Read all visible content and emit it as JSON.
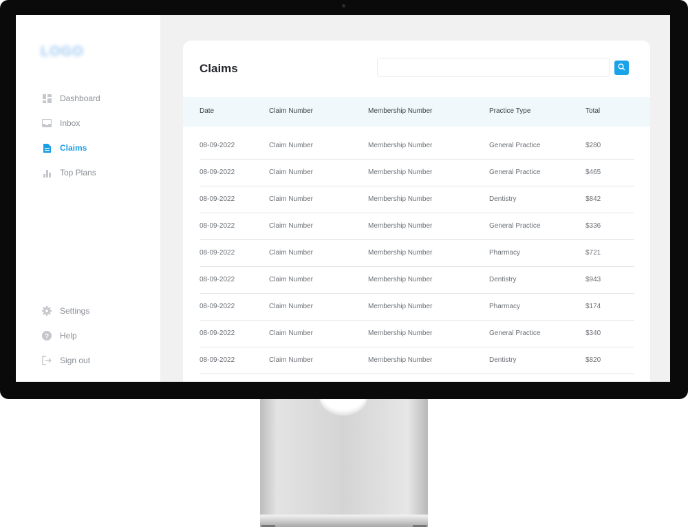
{
  "app": {
    "logo_text": "LOGO"
  },
  "sidebar": {
    "items": [
      {
        "label": "Dashboard",
        "icon": "dashboard-icon",
        "active": false
      },
      {
        "label": "Inbox",
        "icon": "inbox-icon",
        "active": false
      },
      {
        "label": "Claims",
        "icon": "document-icon",
        "active": true
      },
      {
        "label": "Top Plans",
        "icon": "bar-chart-icon",
        "active": false
      }
    ],
    "bottom_items": [
      {
        "label": "Settings",
        "icon": "gear-icon"
      },
      {
        "label": "Help",
        "icon": "help-icon"
      },
      {
        "label": "Sign out",
        "icon": "sign-out-icon"
      }
    ]
  },
  "main": {
    "title": "Claims",
    "search": {
      "placeholder": "",
      "value": ""
    },
    "table": {
      "columns": [
        "Date",
        "Claim Number",
        "Membership Number",
        "Practice Type",
        "Total"
      ],
      "rows": [
        [
          "08-09-2022",
          "Claim Number",
          "Membership Number",
          "General Practice",
          "$280"
        ],
        [
          "08-09-2022",
          "Claim Number",
          "Membership Number",
          "General Practice",
          "$465"
        ],
        [
          "08-09-2022",
          "Claim Number",
          "Membership Number",
          "Dentistry",
          "$842"
        ],
        [
          "08-09-2022",
          "Claim Number",
          "Membership Number",
          "General Practice",
          "$336"
        ],
        [
          "08-09-2022",
          "Claim Number",
          "Membership Number",
          "Pharmacy",
          "$721"
        ],
        [
          "08-09-2022",
          "Claim Number",
          "Membership Number",
          "Dentistry",
          "$943"
        ],
        [
          "08-09-2022",
          "Claim Number",
          "Membership Number",
          "Pharmacy",
          "$174"
        ],
        [
          "08-09-2022",
          "Claim Number",
          "Membership Number",
          "General Practice",
          "$340"
        ],
        [
          "08-09-2022",
          "Claim Number",
          "Membership Number",
          "Dentistry",
          "$820"
        ]
      ]
    }
  },
  "colors": {
    "accent": "#1b9ee8",
    "header_bg": "#f1f8fc",
    "bezel": "#0a0a0a"
  }
}
